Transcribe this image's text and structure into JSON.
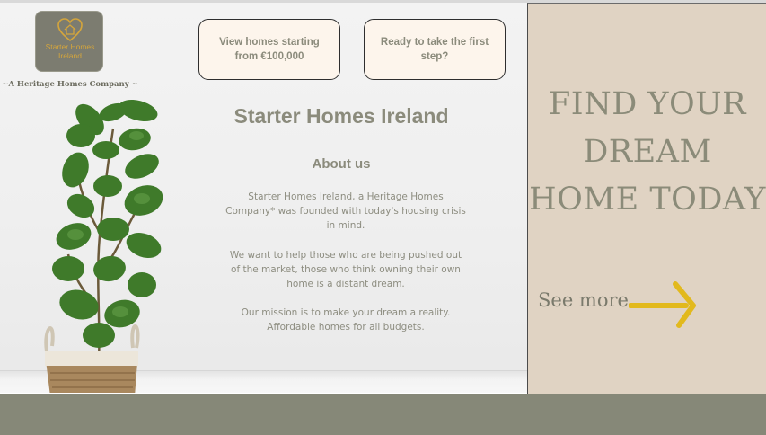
{
  "logo": {
    "name": "Starter Homes Ireland",
    "tagline": "~A Heritage Homes Company ~",
    "colors": {
      "background": "#7c7c70",
      "gold": "#d4a53c"
    }
  },
  "cta": {
    "homes_price": "View homes starting from €100,000",
    "first_step": "Ready to take the first step?"
  },
  "main": {
    "title": "Starter Homes Ireland",
    "about_heading": "About us",
    "paragraphs": [
      "Starter Homes Ireland, a Heritage Homes Company* was founded with today's housing crisis in mind.",
      "We want to help those who are being pushed out of the market, those who think owning their own home is a distant dream.",
      "Our mission is to make your dream a reality. Affordable homes for all budgets."
    ]
  },
  "panel": {
    "heading": "FIND YOUR DREAM HOME TODAY",
    "see_more": "See more",
    "arrow_icon": "arrow-right-icon",
    "colors": {
      "background": "#e0d3c3",
      "arrow": "#e2b91d",
      "text": "#8b8b79"
    }
  },
  "colors": {
    "accent_text": "#8b8b7c",
    "footer": "#868878",
    "button_bg": "#fdf5ec"
  }
}
